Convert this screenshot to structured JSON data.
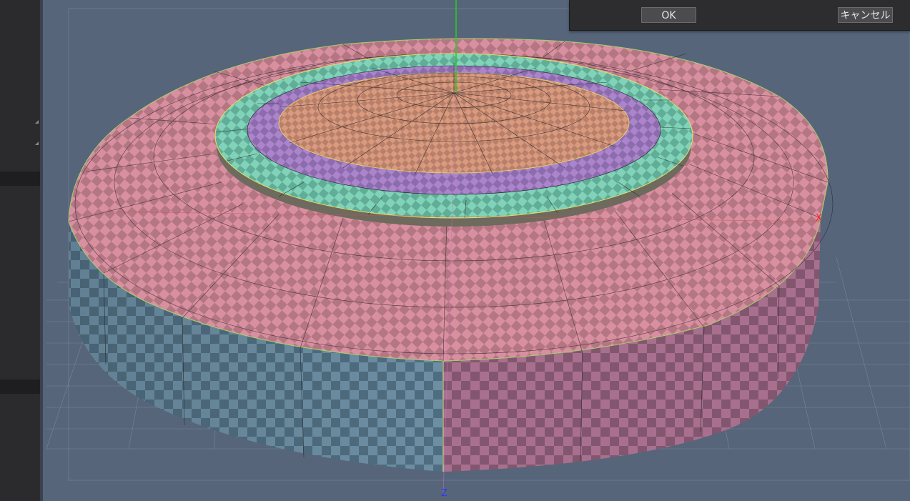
{
  "dialog": {
    "ok_label": "OK",
    "cancel_label": "キャンセル"
  },
  "viewport": {
    "axis_x_label": "X",
    "axis_z_label": "Z"
  },
  "colors": {
    "viewport_bg": "#56657a",
    "axis_x": "#ff2020",
    "axis_y": "#20d020",
    "axis_z": "#2a3cff",
    "ring_outer": "#d890a0",
    "ring_teal": "#7ed1b6",
    "ring_purple": "#a880c8",
    "top_center": "#d8987c",
    "side_left": "#6d8ea3",
    "side_right": "#a8708e"
  }
}
